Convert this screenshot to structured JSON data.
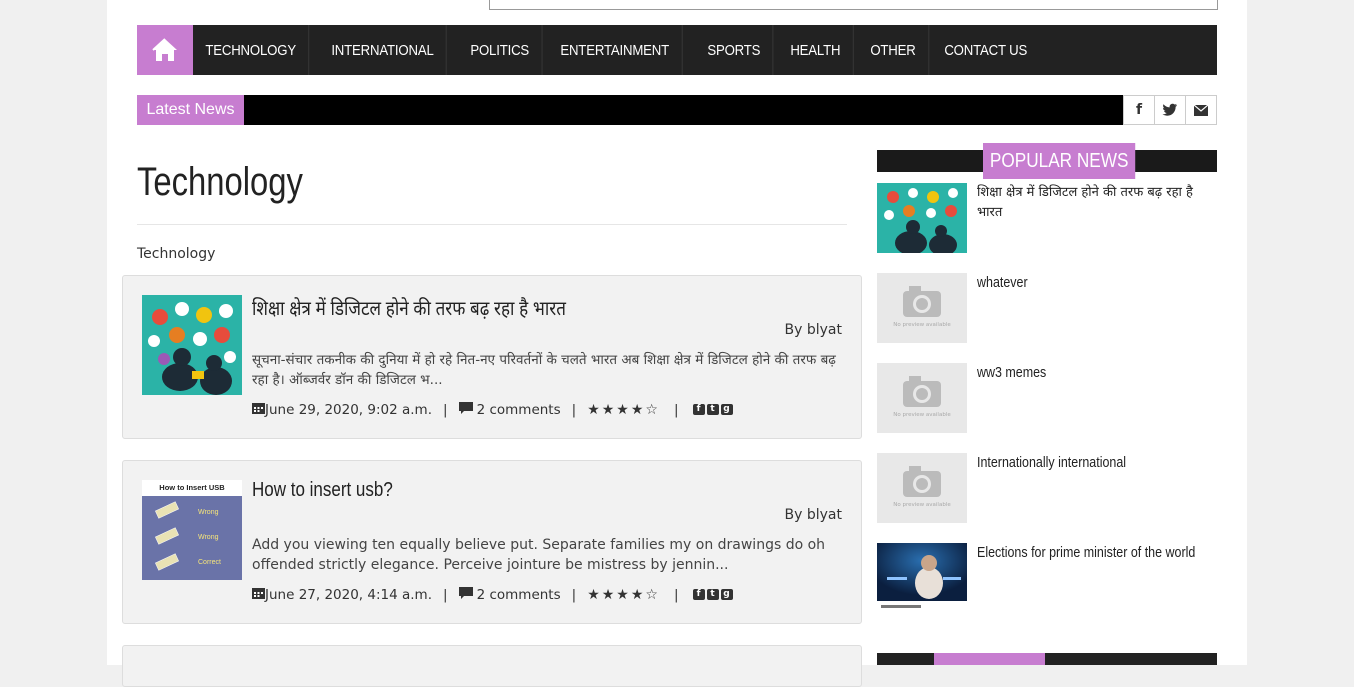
{
  "nav": {
    "items": [
      "TECHNOLOGY",
      "INTERNATIONAL",
      "POLITICS",
      "ENTERTAINMENT",
      "SPORTS",
      "HEALTH",
      "OTHER",
      "CONTACT US"
    ]
  },
  "ticker": {
    "label": "Latest News"
  },
  "page": {
    "title": "Technology",
    "breadcrumb": "Technology"
  },
  "posts": [
    {
      "title": "शिक्षा क्षेत्र में डिजिटल होने की तरफ बढ़ रहा है भारत",
      "author": "By blyat",
      "excerpt": "सूचना-संचार तकनीक की दुनिया में हो रहे नित-नए परिवर्तनों के चलते भारत अब शिक्षा क्षेत्र में डिजिटल होने की तरफ बढ़ रहा है। ऑब्जर्वर डॉन की डिजिटल भ...",
      "date": "June 29, 2020, 9:02 a.m.",
      "comments": "2 comments",
      "stars": "★★★★☆"
    },
    {
      "title": "How to insert usb?",
      "author": "By blyat",
      "excerpt": "Add you viewing ten equally believe put. Separate families my on drawings do oh offended strictly elegance. Perceive jointure be mistress by jennin...",
      "date": "June 27, 2020, 4:14 a.m.",
      "comments": "2 comments",
      "stars": "★★★★☆",
      "thumb_text": [
        "How to Insert USB",
        "Wrong",
        "Wrong",
        "Correct"
      ]
    }
  ],
  "sidebar": {
    "heading": "POPULAR NEWS",
    "items": [
      {
        "title": "शिक्षा क्षेत्र में डिजिटल होने की तरफ बढ़ रहा है भारत"
      },
      {
        "title": "whatever"
      },
      {
        "title": "ww3 memes"
      },
      {
        "title": "Internationally international"
      },
      {
        "title": "Elections for prime minister of the world"
      }
    ],
    "no_preview": "No preview available"
  },
  "colors": {
    "accent": "#c77dd0",
    "nav_bg": "#222222"
  }
}
